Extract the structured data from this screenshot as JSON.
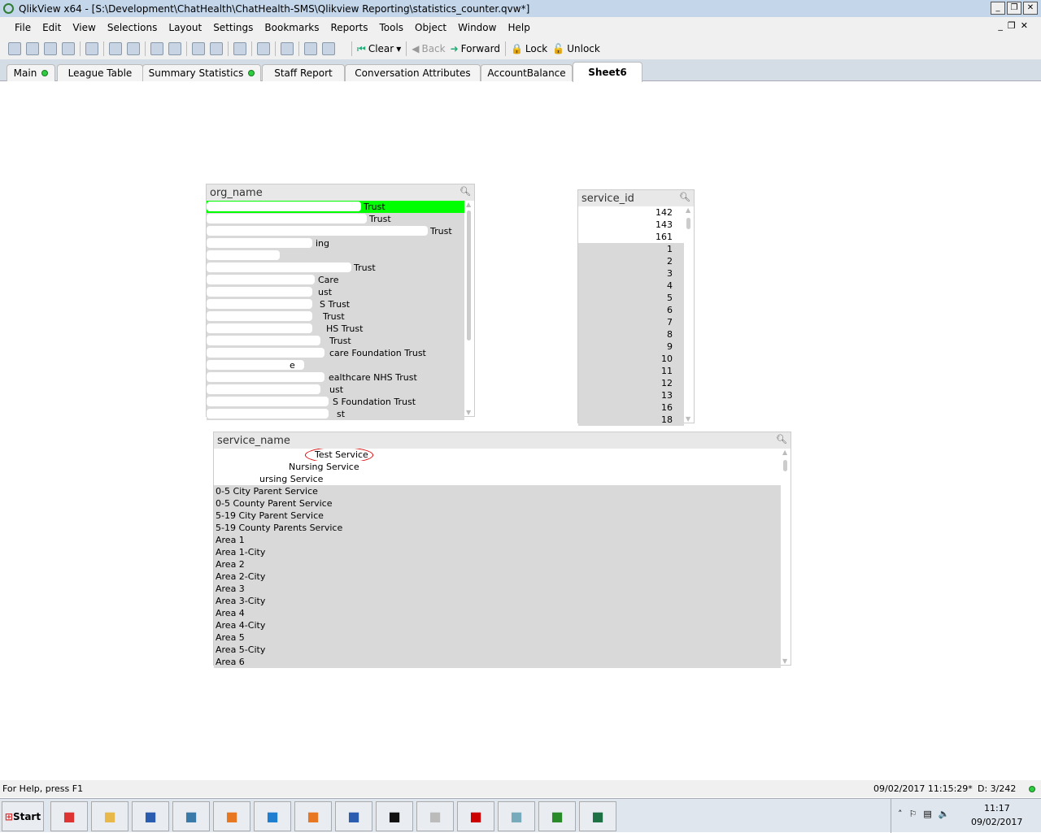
{
  "window": {
    "title": "QlikView x64 - [S:\\Development\\ChatHealth\\ChatHealth-SMS\\Qlikview Reporting\\statistics_counter.qvw*]"
  },
  "menu": [
    "File",
    "Edit",
    "View",
    "Selections",
    "Layout",
    "Settings",
    "Bookmarks",
    "Reports",
    "Tools",
    "Object",
    "Window",
    "Help"
  ],
  "toolbar": {
    "clear": "Clear",
    "back": "Back",
    "forward": "Forward",
    "lock": "Lock",
    "unlock": "Unlock"
  },
  "tabs": [
    {
      "label": "Main",
      "dot": true
    },
    {
      "label": "League Table"
    },
    {
      "label": "Summary Statistics",
      "dot": true
    },
    {
      "label": "Staff Report"
    },
    {
      "label": "Conversation Attributes"
    },
    {
      "label": "AccountBalance"
    },
    {
      "label": "Sheet6",
      "active": true
    }
  ],
  "org_name": {
    "title": "org_name",
    "items": [
      {
        "text": "Trust",
        "state": "selected"
      },
      {
        "text": "Trust",
        "state": "excluded"
      },
      {
        "text": "Trust",
        "state": "excluded"
      },
      {
        "text": "ing",
        "state": "excluded"
      },
      {
        "text": "",
        "state": "excluded"
      },
      {
        "text": "Trust",
        "state": "excluded"
      },
      {
        "text": "Care",
        "state": "excluded"
      },
      {
        "text": "ust",
        "state": "excluded"
      },
      {
        "text": "S Trust",
        "state": "excluded"
      },
      {
        "text": "Trust",
        "state": "excluded"
      },
      {
        "text": "HS Trust",
        "state": "excluded"
      },
      {
        "text": "Trust",
        "state": "excluded"
      },
      {
        "text": "care Foundation Trust",
        "state": "excluded"
      },
      {
        "text": "e",
        "state": "excluded"
      },
      {
        "text": "ealthcare NHS Trust",
        "state": "excluded"
      },
      {
        "text": "ust",
        "state": "excluded"
      },
      {
        "text": "S Foundation Trust",
        "state": "excluded"
      },
      {
        "text": "st",
        "state": "excluded"
      }
    ]
  },
  "service_id": {
    "title": "service_id",
    "items": [
      {
        "text": "142",
        "state": "possible"
      },
      {
        "text": "143",
        "state": "possible"
      },
      {
        "text": "161",
        "state": "possible"
      },
      {
        "text": "1",
        "state": "excluded"
      },
      {
        "text": "2",
        "state": "excluded"
      },
      {
        "text": "3",
        "state": "excluded"
      },
      {
        "text": "4",
        "state": "excluded"
      },
      {
        "text": "5",
        "state": "excluded"
      },
      {
        "text": "6",
        "state": "excluded"
      },
      {
        "text": "7",
        "state": "excluded"
      },
      {
        "text": "8",
        "state": "excluded"
      },
      {
        "text": "9",
        "state": "excluded"
      },
      {
        "text": "10",
        "state": "excluded"
      },
      {
        "text": "11",
        "state": "excluded"
      },
      {
        "text": "12",
        "state": "excluded"
      },
      {
        "text": "13",
        "state": "excluded"
      },
      {
        "text": "16",
        "state": "excluded"
      },
      {
        "text": "18",
        "state": "excluded"
      }
    ]
  },
  "service_name": {
    "title": "service_name",
    "items": [
      {
        "text": "Test Service",
        "state": "possible",
        "annotated": true
      },
      {
        "text": "Nursing Service",
        "state": "possible"
      },
      {
        "text": "ursing Service",
        "state": "possible"
      },
      {
        "text": "0-5 City Parent Service",
        "state": "excluded"
      },
      {
        "text": "0-5 County Parent Service",
        "state": "excluded"
      },
      {
        "text": "5-19 City Parent Service",
        "state": "excluded"
      },
      {
        "text": "5-19 County Parents Service",
        "state": "excluded"
      },
      {
        "text": "Area 1",
        "state": "excluded"
      },
      {
        "text": "Area 1-City",
        "state": "excluded"
      },
      {
        "text": "Area 2",
        "state": "excluded"
      },
      {
        "text": "Area 2-City",
        "state": "excluded"
      },
      {
        "text": "Area 3",
        "state": "excluded"
      },
      {
        "text": "Area 3-City",
        "state": "excluded"
      },
      {
        "text": "Area 4",
        "state": "excluded"
      },
      {
        "text": "Area 4-City",
        "state": "excluded"
      },
      {
        "text": "Area 5",
        "state": "excluded"
      },
      {
        "text": "Area 5-City",
        "state": "excluded"
      },
      {
        "text": "Area 6",
        "state": "excluded"
      }
    ]
  },
  "status": {
    "help": "For Help, press F1",
    "timestamp": "09/02/2017 11:15:29*",
    "distinct": "D: 3/242"
  },
  "taskbar": {
    "start": "Start",
    "time": "11:17",
    "date": "09/02/2017",
    "apps": [
      "chrome-icon",
      "explorer-icon",
      "remote-desktop-icon",
      "network-icon",
      "media-player-icon",
      "internet-explorer-icon",
      "outlook-icon",
      "document-icon",
      "cmd-icon",
      "jx-icon",
      "pdf-icon",
      "notepad-icon",
      "qlikview-icon",
      "excel-icon"
    ]
  },
  "colors": {
    "selected": "#00ff00",
    "excluded": "#d9d9d9",
    "possible": "#ffffff",
    "annotation": "#e00000"
  }
}
